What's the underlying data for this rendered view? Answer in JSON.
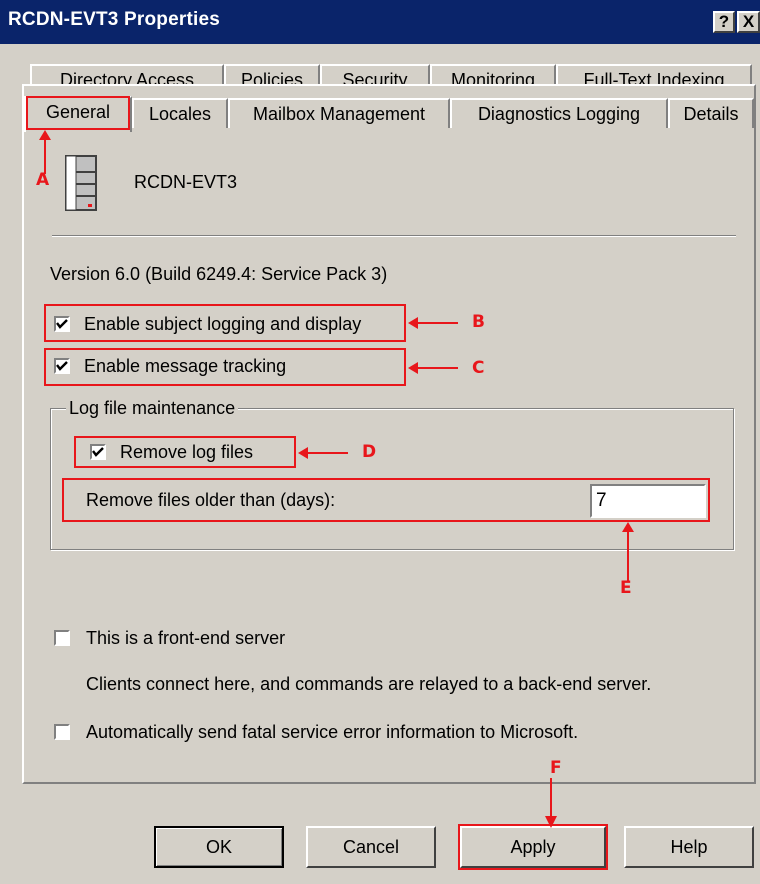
{
  "window": {
    "title": "RCDN-EVT3 Properties",
    "help_glyph": "?",
    "close_glyph": "X"
  },
  "tabs": {
    "row_back": [
      "Directory Access",
      "Policies",
      "Security",
      "Monitoring",
      "Full-Text Indexing"
    ],
    "row_front": [
      "General",
      "Locales",
      "Mailbox Management",
      "Diagnostics Logging",
      "Details"
    ],
    "active": "General"
  },
  "general": {
    "server_icon": "server-icon",
    "server_name": "RCDN-EVT3",
    "version": "Version 6.0 (Build 6249.4: Service Pack 3)",
    "subject_logging_label": "Enable subject logging and display",
    "subject_logging_checked": true,
    "message_tracking_label": "Enable message tracking",
    "message_tracking_checked": true,
    "log_group_label": "Log file maintenance",
    "remove_log_label": "Remove log files",
    "remove_log_checked": true,
    "remove_older_label": "Remove files older than (days):",
    "remove_older_value": "7",
    "front_end_label": "This is a front-end server",
    "front_end_checked": false,
    "front_end_desc": "Clients connect here, and commands are relayed to a back-end server.",
    "auto_send_label": "Automatically send fatal service error information to Microsoft.",
    "auto_send_checked": false
  },
  "buttons": {
    "ok": "OK",
    "cancel": "Cancel",
    "apply": "Apply",
    "help": "Help"
  },
  "annotations": {
    "color": "#e8161b",
    "letters": [
      "A",
      "B",
      "C",
      "D",
      "E",
      "F"
    ]
  }
}
